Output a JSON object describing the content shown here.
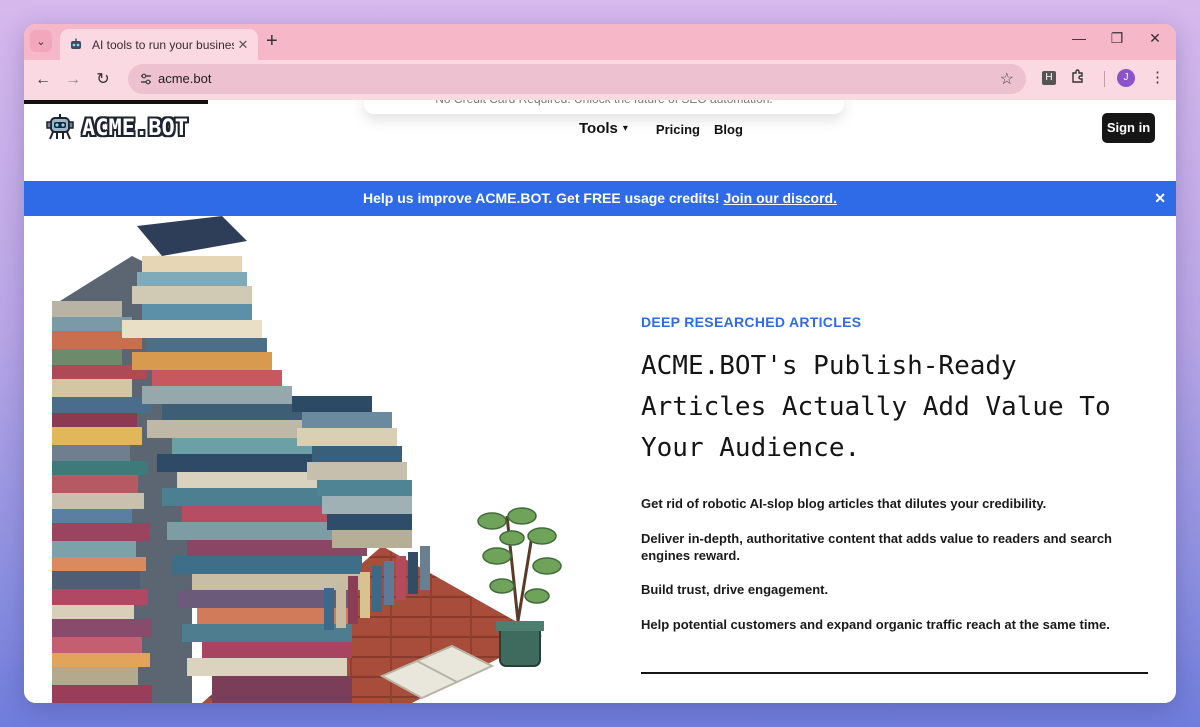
{
  "browser": {
    "tab_title": "AI tools to run your business - /",
    "url": "acme.bot",
    "profile_initial": "J",
    "extension_label": "H"
  },
  "page": {
    "ghost_banner": "No Credit Card Required. Unlock the future of SEO automation.",
    "logo_text": "ACME.BOT",
    "nav": {
      "tools": "Tools",
      "pricing": "Pricing",
      "blog": "Blog",
      "signin": "Sign in"
    },
    "announcement": {
      "text": "Help us improve ACME.BOT. Get FREE usage credits! ",
      "link": "Join our discord."
    },
    "hero": {
      "eyebrow": "DEEP RESEARCHED ARTICLES",
      "headline": "ACME.BOT's Publish-Ready Articles Actually Add Value To Your Audience.",
      "p1": "Get rid of robotic AI-slop blog articles that dilutes your credibility.",
      "p2": "Deliver in-depth, authoritative content that adds value to readers and search engines reward.",
      "p3": "Build trust, drive engagement.",
      "p4": "Help potential customers and expand organic traffic reach at the same time."
    }
  },
  "colors": {
    "accent": "#2f6be6",
    "tabbar": "#f6b7c9",
    "toolbar": "#fbd9e2"
  },
  "icons": {
    "tab_search": "chevron-down-icon",
    "favicon": "robot-icon",
    "back": "back-arrow-icon",
    "forward": "forward-arrow-icon",
    "reload": "reload-icon",
    "site_info": "tune-icon",
    "bookmark": "star-icon",
    "extensions": "puzzle-icon",
    "menu": "kebab-icon"
  }
}
